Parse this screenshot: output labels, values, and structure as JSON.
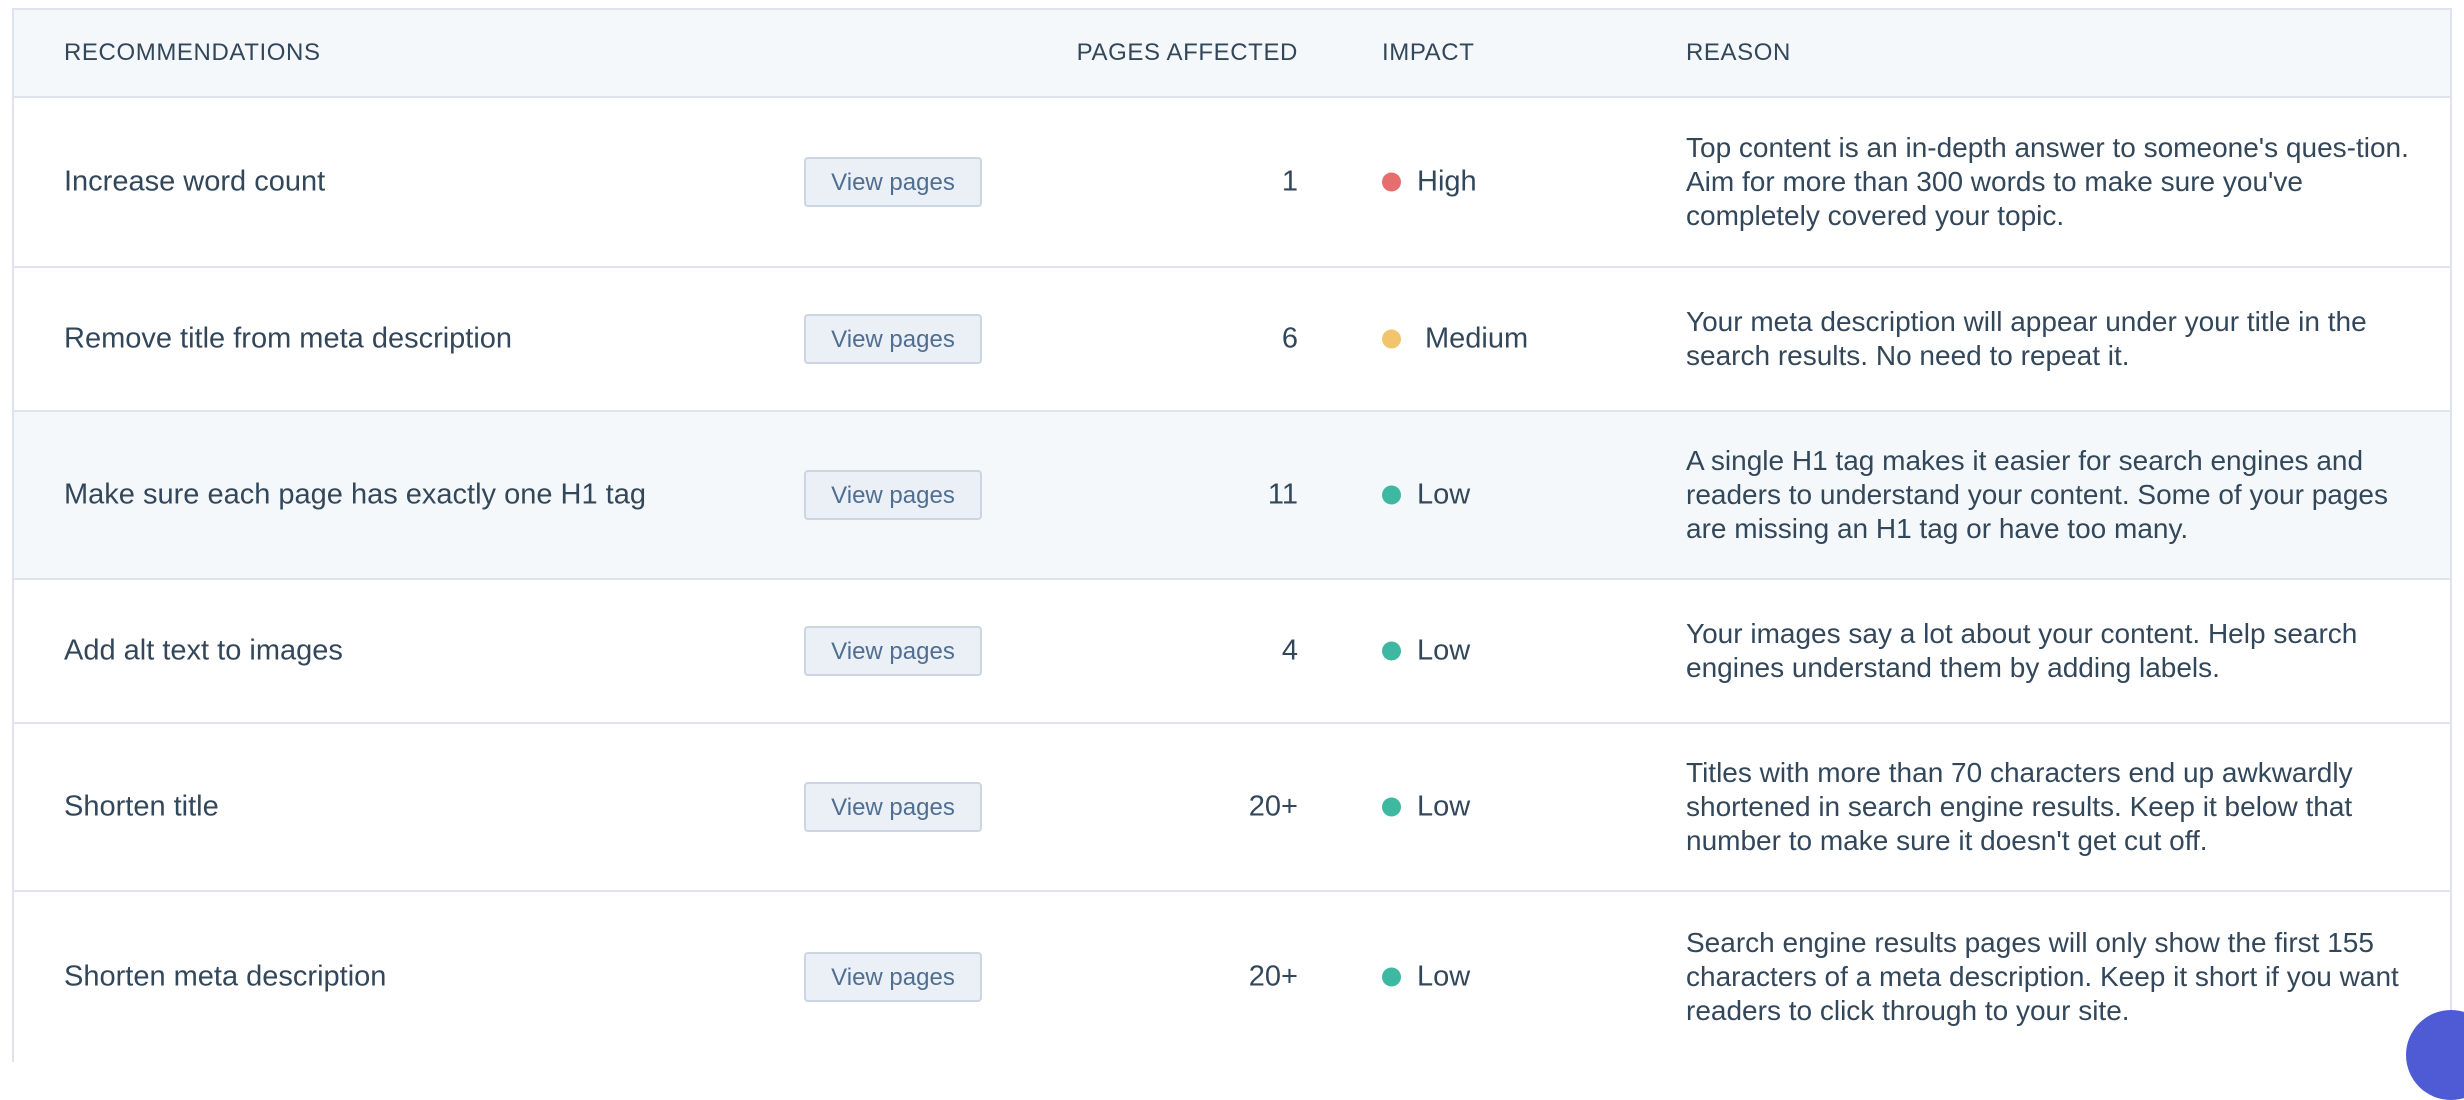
{
  "header": {
    "recommendations": "RECOMMENDATIONS",
    "pages_affected": "PAGES AFFECTED",
    "impact": "IMPACT",
    "reason": "REASON"
  },
  "colors": {
    "high": "#e66e6e",
    "medium": "#f2c46e",
    "low": "#3eb8a0"
  },
  "rows": [
    {
      "name": "Increase word count",
      "button": "View pages",
      "count": "1",
      "impact": "High",
      "impact_color": "#e66e6e",
      "reason": "Top content is an in-depth answer to someone's ques-tion. Aim for more than 300 words to make sure you've completely covered your topic."
    },
    {
      "name": "Remove title from meta description",
      "button": "View pages",
      "count": "6",
      "impact": "Medium",
      "impact_color": "#f2c46e",
      "reason": "Your meta description will appear under your title in the search results. No need to repeat it."
    },
    {
      "name": "Make sure each page has exactly one H1 tag",
      "button": "View pages",
      "count": "11",
      "impact": "Low",
      "impact_color": "#3eb8a0",
      "reason": "A single H1 tag makes it easier for search engines and readers to understand your content. Some of your pages are missing an H1 tag or have too many."
    },
    {
      "name": "Add alt text to images",
      "button": "View pages",
      "count": "4",
      "impact": "Low",
      "impact_color": "#3eb8a0",
      "reason": "Your images say a lot about your content. Help search engines understand them by adding labels."
    },
    {
      "name": "Shorten title",
      "button": "View pages",
      "count": "20+",
      "impact": "Low",
      "impact_color": "#3eb8a0",
      "reason": "Titles with more than 70 characters end up awkwardly shortened in search engine results. Keep it below that number to make sure it doesn't get cut off."
    },
    {
      "name": "Shorten meta description",
      "button": "View pages",
      "count": "20+",
      "impact": "Low",
      "impact_color": "#3eb8a0",
      "reason": "Search engine results pages will only show the first 155 characters of a meta description. Keep it short if you want readers to click through to your site."
    }
  ]
}
